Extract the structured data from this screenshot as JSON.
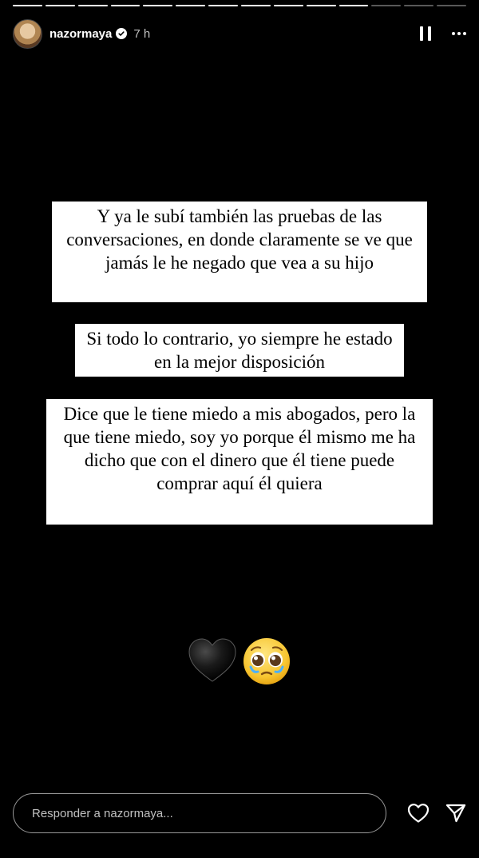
{
  "story": {
    "segments_total": 14,
    "segments_done": 11
  },
  "header": {
    "username": "nazormaya",
    "time": "7 h",
    "icons": [
      "avatar",
      "verified-badge-icon",
      "pause-icon",
      "more-icon"
    ]
  },
  "texts": [
    "Y ya le subí también las pruebas de las conversaciones, en donde claramente se ve que jamás le he negado que vea a su hijo",
    "Si todo lo contrario, yo siempre he estado en la mejor disposición",
    "Dice que le tiene miedo a mis abogados, pero la que tiene miedo, soy yo porque él mismo me ha dicho que con el dinero que él tiene puede comprar aquí él quiera"
  ],
  "emojis": [
    "black-heart-icon",
    "pleading-face-icon"
  ],
  "reply": {
    "placeholder": "Responder a nazormaya..."
  },
  "reply_icons": [
    "heart-icon",
    "send-icon"
  ]
}
